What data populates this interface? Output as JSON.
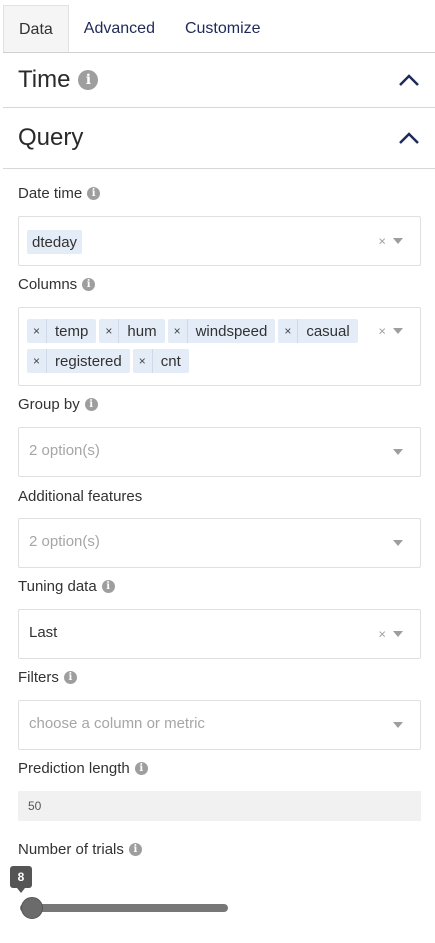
{
  "tabs": [
    {
      "label": "Data",
      "active": true
    },
    {
      "label": "Advanced",
      "active": false
    },
    {
      "label": "Customize",
      "active": false
    }
  ],
  "sections": {
    "time": {
      "title": "Time"
    },
    "query": {
      "title": "Query"
    }
  },
  "fields": {
    "date_time": {
      "label": "Date time",
      "value": "dteday"
    },
    "columns": {
      "label": "Columns",
      "values": [
        "temp",
        "hum",
        "windspeed",
        "casual",
        "registered",
        "cnt"
      ]
    },
    "group_by": {
      "label": "Group by",
      "placeholder": "2 option(s)"
    },
    "additional_features": {
      "label": "Additional features",
      "placeholder": "2 option(s)"
    },
    "tuning_data": {
      "label": "Tuning data",
      "value": "Last"
    },
    "filters": {
      "label": "Filters",
      "placeholder": "choose a column or metric"
    },
    "prediction_length": {
      "label": "Prediction length",
      "value": "50"
    },
    "number_of_trials": {
      "label": "Number of trials",
      "value": "8"
    }
  },
  "icons": {
    "info": "info-icon",
    "collapse": "chevron-up-icon",
    "clear": "clear-icon",
    "dropdown": "caret-down-icon",
    "remove_chip": "remove-icon"
  },
  "colors": {
    "tab_text": "#1f2a5a",
    "chip_bg": "#e4ecf7",
    "chevron": "#1f2a5a",
    "slider": "#6b6b6b"
  },
  "clear_glyph": "×",
  "info_glyph": "i"
}
